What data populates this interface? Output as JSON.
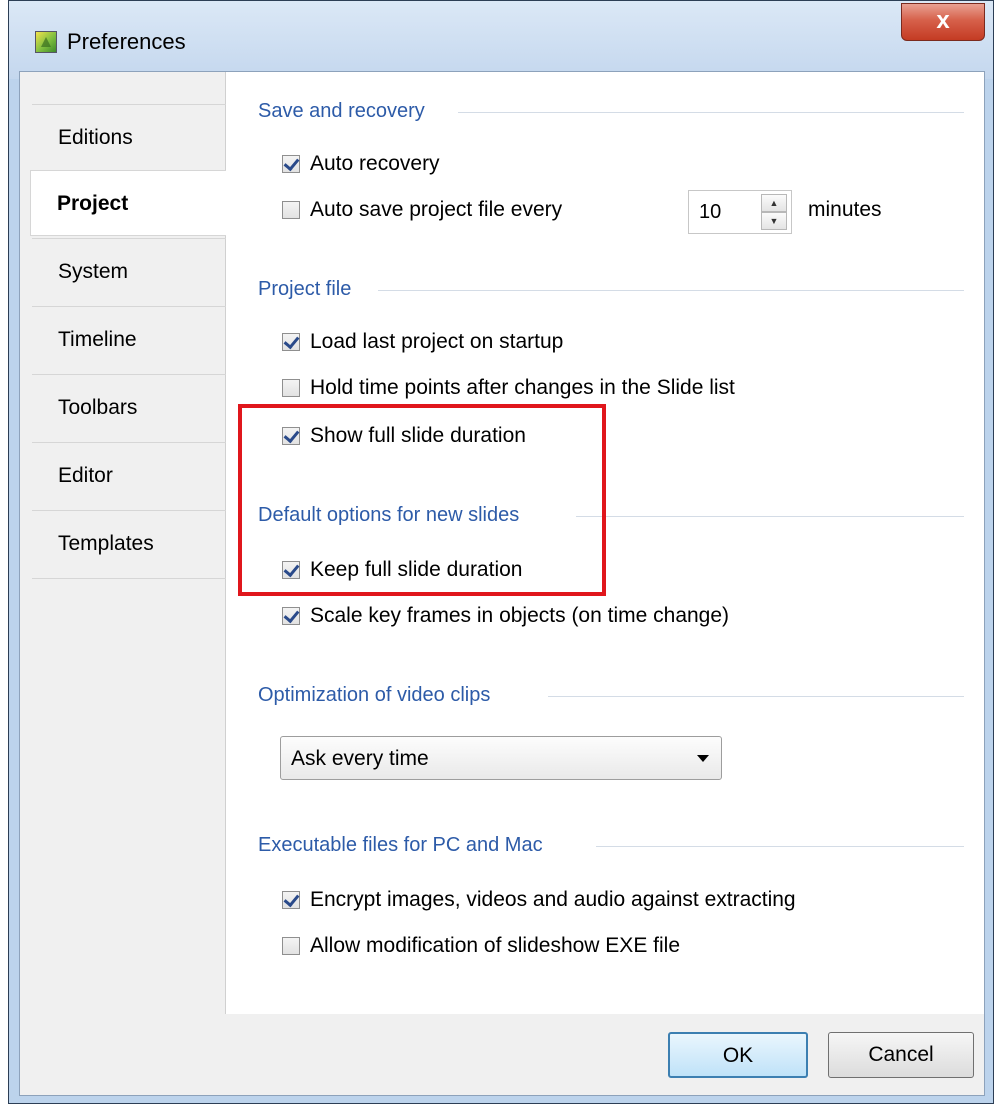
{
  "window": {
    "title": "Preferences",
    "close_label": "x"
  },
  "sidebar": {
    "items": [
      {
        "label": "Editions",
        "active": false
      },
      {
        "label": "Project",
        "active": true
      },
      {
        "label": "System",
        "active": false
      },
      {
        "label": "Timeline",
        "active": false
      },
      {
        "label": "Toolbars",
        "active": false
      },
      {
        "label": "Editor",
        "active": false
      },
      {
        "label": "Templates",
        "active": false
      }
    ]
  },
  "save_recovery": {
    "title": "Save and recovery",
    "auto_recovery": {
      "label": "Auto recovery",
      "checked": true
    },
    "auto_save": {
      "label": "Auto save project file every",
      "checked": false
    },
    "interval_value": "10",
    "interval_unit": "minutes"
  },
  "project_file": {
    "title": "Project file",
    "load_last": {
      "label": "Load last project on startup",
      "checked": true
    },
    "hold_time": {
      "label": "Hold time points after changes in the Slide list",
      "checked": false
    },
    "show_full": {
      "label": "Show full slide duration",
      "checked": true
    }
  },
  "default_options": {
    "title": "Default options for new slides",
    "keep_full": {
      "label": "Keep full slide duration",
      "checked": true
    },
    "scale_key": {
      "label": "Scale key frames in objects (on time change)",
      "checked": true
    }
  },
  "optimization": {
    "title": "Optimization of video clips",
    "selected": "Ask every time"
  },
  "executable": {
    "title": "Executable files for PC and Mac",
    "encrypt": {
      "label": "Encrypt images, videos and audio against extracting",
      "checked": true
    },
    "allow_mod": {
      "label": "Allow modification of slideshow EXE file",
      "checked": false
    }
  },
  "footer": {
    "ok_label": "OK",
    "cancel_label": "Cancel"
  },
  "colors": {
    "group_title": "#2d5ba8",
    "highlight": "#e0161c"
  }
}
